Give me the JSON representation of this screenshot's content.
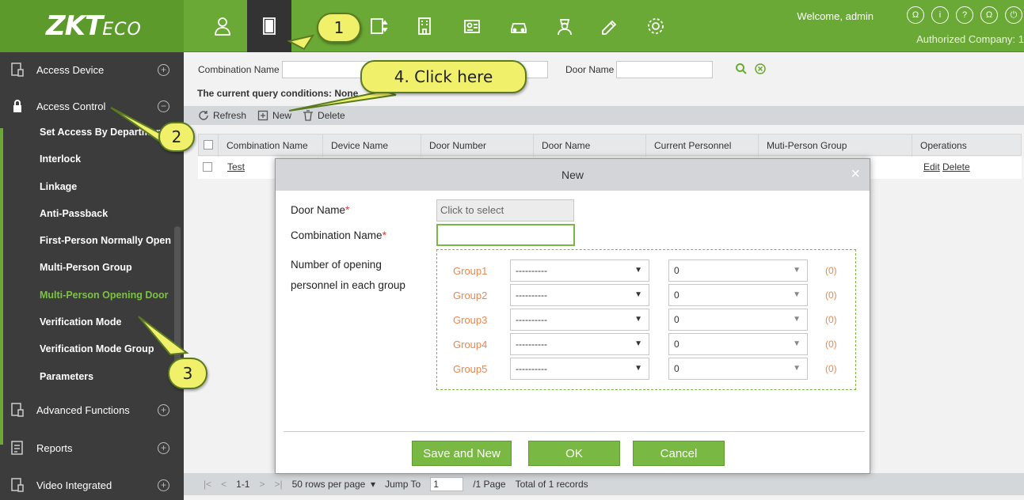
{
  "header": {
    "logo": "ZKTeco",
    "welcome": "Welcome, admin",
    "company": "Authorized Company: 1",
    "nav_icons": [
      "personnel-icon",
      "door-access-icon",
      "elevator-icon",
      "building-icon",
      "visitor-icon",
      "car-parking-icon",
      "patrol-guard-icon",
      "edit-icon",
      "system-settings-icon"
    ],
    "right_icons": [
      "Ω",
      "i",
      "?",
      "Ω",
      "⏻"
    ]
  },
  "sidebar": {
    "sections": [
      {
        "label": "Access Device",
        "toggle": "+"
      },
      {
        "label": "Access Control",
        "toggle": "−"
      },
      {
        "label": "Advanced Functions",
        "toggle": "+"
      },
      {
        "label": "Reports",
        "toggle": "+"
      },
      {
        "label": "Video Integrated",
        "toggle": "+"
      }
    ],
    "items": [
      "Set Access By Department",
      "Interlock",
      "Linkage",
      "Anti-Passback",
      "First-Person Normally Open",
      "Multi-Person Group",
      "Multi-Person Opening Door",
      "Verification Mode",
      "Verification Mode Group",
      "Parameters"
    ]
  },
  "search": {
    "combination_label": "Combination Name",
    "door_label": "Door Name",
    "query_text": "The current query conditions: None"
  },
  "toolbar": {
    "refresh": "Refresh",
    "new": "New",
    "delete": "Delete"
  },
  "table": {
    "columns": [
      "Combination Name",
      "Device Name",
      "Door Number",
      "Door Name",
      "Current Personnel Count",
      "Muti-Person Group",
      "Operations"
    ],
    "rows": [
      {
        "combination": "Test",
        "edit": "Edit",
        "delete": "Delete"
      }
    ]
  },
  "pager": {
    "range": "1-1",
    "rows_per_page": "50 rows per page",
    "jump_label": "Jump To",
    "jump_value": "1",
    "pages": "/1 Page",
    "total": "Total of 1 records"
  },
  "modal": {
    "title": "New",
    "close": "×",
    "door_name_label": "Door Name",
    "door_name_placeholder": "Click to select",
    "combination_label": "Combination Name",
    "required_mark": "*",
    "groups_label": "Number of opening personnel in each group",
    "groups": [
      {
        "name": "Group1",
        "group": "----------",
        "number": "0",
        "count": "(0)"
      },
      {
        "name": "Group2",
        "group": "----------",
        "number": "0",
        "count": "(0)"
      },
      {
        "name": "Group3",
        "group": "----------",
        "number": "0",
        "count": "(0)"
      },
      {
        "name": "Group4",
        "group": "----------",
        "number": "0",
        "count": "(0)"
      },
      {
        "name": "Group5",
        "group": "----------",
        "number": "0",
        "count": "(0)"
      }
    ],
    "buttons": {
      "save_new": "Save and New",
      "ok": "OK",
      "cancel": "Cancel"
    }
  },
  "callouts": [
    "1",
    "2",
    "3",
    "4. Click here"
  ],
  "colors": {
    "brand_green": "#6aa935",
    "sidebar_bg": "#3c3c3c",
    "active_item": "#7cc244",
    "group_label": "#e9874e",
    "callout_fill": "#f0f06a"
  }
}
